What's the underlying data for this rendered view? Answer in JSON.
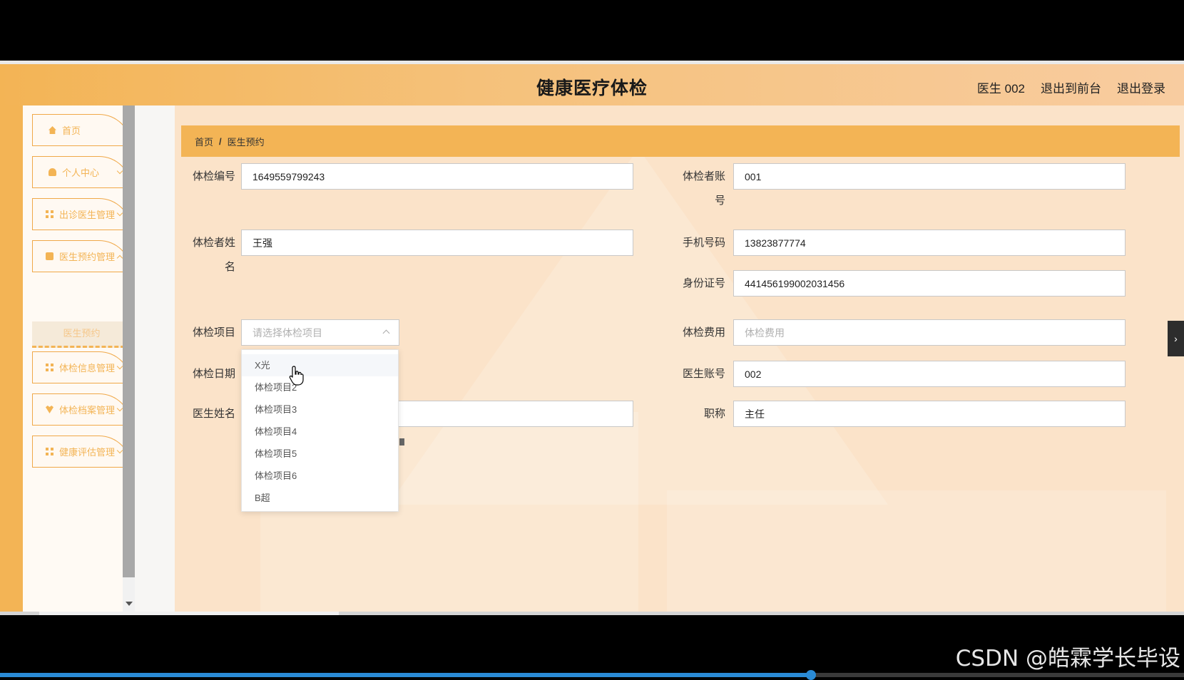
{
  "header": {
    "title": "健康医疗体检",
    "user": "医生 002",
    "back_to_front": "退出到前台",
    "logout": "退出登录"
  },
  "sidebar": {
    "items": [
      {
        "label": "首页",
        "icon": "home-icon"
      },
      {
        "label": "个人中心",
        "icon": "user-icon"
      },
      {
        "label": "出诊医生管理",
        "icon": "grid-icon"
      },
      {
        "label": "医生预约管理",
        "icon": "bag-icon"
      },
      {
        "label": "体检信息管理",
        "icon": "grid-icon"
      },
      {
        "label": "体检档案管理",
        "icon": "heart-icon"
      },
      {
        "label": "健康评估管理",
        "icon": "grid-icon"
      }
    ],
    "submenu": {
      "label": "医生预约"
    }
  },
  "breadcrumb": {
    "home": "首页",
    "separator": "/",
    "current": "医生预约"
  },
  "form": {
    "exam_no": {
      "label": "体检编号",
      "value": "1649559799243"
    },
    "examinee_account": {
      "label_1": "体检者账",
      "label_2": "号",
      "value": "001"
    },
    "examinee_name": {
      "label_1": "体检者姓",
      "label_2": "名",
      "value": "王强"
    },
    "phone": {
      "label": "手机号码",
      "value": "13823877774"
    },
    "id_card": {
      "label": "身份证号",
      "value": "441456199002031456"
    },
    "exam_item": {
      "label": "体检项目",
      "placeholder": "请选择体检项目"
    },
    "exam_fee": {
      "label": "体检费用",
      "placeholder": "体检费用"
    },
    "exam_date": {
      "label": "体检日期"
    },
    "doctor_account": {
      "label": "医生账号",
      "value": "002"
    },
    "doctor_name": {
      "label": "医生姓名"
    },
    "title": {
      "label": "职称",
      "value": "主任"
    }
  },
  "dropdown": {
    "options": [
      "X光",
      "体检项目2",
      "体检项目3",
      "体检项目4",
      "体检项目5",
      "体检项目6",
      "B超"
    ]
  },
  "watermark": "CSDN @皓霖学长毕设",
  "colors": {
    "accent": "#f3b455",
    "background": "#fbe3c9"
  }
}
